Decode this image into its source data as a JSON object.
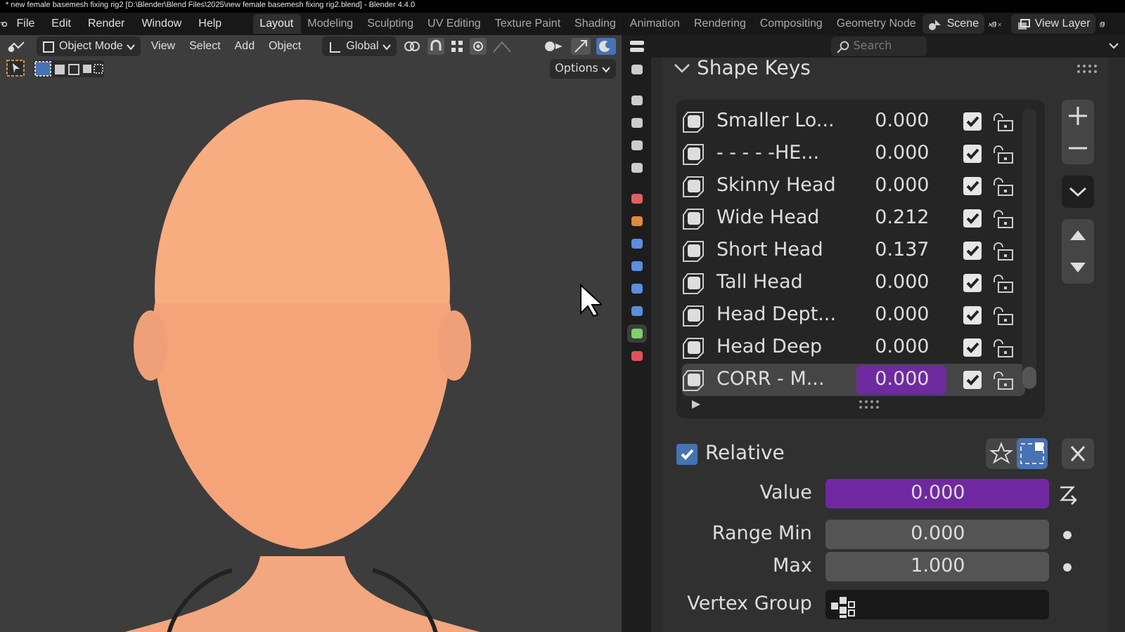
{
  "window": {
    "title": "* new female basemesh fixing rig2 [D:\\Blender\\Blend Files\\2025\\new female basemesh fixing rig2.blend] - Blender 4.4.0"
  },
  "menu": [
    "File",
    "Edit",
    "Render",
    "Window",
    "Help"
  ],
  "workspaces": [
    {
      "label": "Layout",
      "selected": true
    },
    {
      "label": "Modeling",
      "selected": false
    },
    {
      "label": "Sculpting",
      "selected": false
    },
    {
      "label": "UV Editing",
      "selected": false
    },
    {
      "label": "Texture Paint",
      "selected": false
    },
    {
      "label": "Shading",
      "selected": false
    },
    {
      "label": "Animation",
      "selected": false
    },
    {
      "label": "Rendering",
      "selected": false
    },
    {
      "label": "Compositing",
      "selected": false
    },
    {
      "label": "Geometry Node",
      "selected": false
    }
  ],
  "scene": {
    "name": "Scene"
  },
  "view_layer": {
    "name": "View Layer"
  },
  "viewport": {
    "mode": "Object Mode",
    "menus": [
      "View",
      "Select",
      "Add",
      "Object"
    ],
    "orientation": "Global",
    "options": "Options"
  },
  "properties": {
    "search": {
      "placeholder": "Search"
    },
    "tabs": [
      {
        "selected": false
      },
      {
        "selected": false
      },
      {
        "selected": false
      },
      {
        "selected": false
      },
      {
        "selected": false
      },
      {
        "selected": false
      },
      {
        "selected": false
      },
      {
        "selected": false
      },
      {
        "selected": false
      },
      {
        "selected": false
      },
      {
        "selected": false
      },
      {
        "selected": true
      },
      {
        "selected": false
      }
    ],
    "panel_title": "Shape Keys",
    "shape_keys": [
      {
        "name": "Smaller Lo...",
        "value": "0.000",
        "enabled": true,
        "driven": false,
        "selected": false
      },
      {
        "name": "- - - - -HE...",
        "value": "0.000",
        "enabled": true,
        "driven": false,
        "selected": false
      },
      {
        "name": "Skinny Head",
        "value": "0.000",
        "enabled": true,
        "driven": false,
        "selected": false
      },
      {
        "name": "Wide Head",
        "value": "0.212",
        "enabled": true,
        "driven": false,
        "selected": false
      },
      {
        "name": "Short Head",
        "value": "0.137",
        "enabled": true,
        "driven": false,
        "selected": false
      },
      {
        "name": "Tall Head",
        "value": "0.000",
        "enabled": true,
        "driven": false,
        "selected": false
      },
      {
        "name": "Head Dept...",
        "value": "0.000",
        "enabled": true,
        "driven": false,
        "selected": false
      },
      {
        "name": "Head Deep",
        "value": "0.000",
        "enabled": true,
        "driven": false,
        "selected": false
      },
      {
        "name": "CORR - M...",
        "value": "0.000",
        "enabled": true,
        "driven": true,
        "selected": true
      }
    ],
    "relative": {
      "label": "Relative",
      "checked": true
    },
    "fields": [
      {
        "label": "Value",
        "value": "0.000",
        "driven": true,
        "kind": "number"
      },
      {
        "label": "Range Min",
        "value": "0.000",
        "driven": false,
        "kind": "number"
      },
      {
        "label": "Max",
        "value": "1.000",
        "driven": false,
        "kind": "number"
      },
      {
        "label": "Vertex Group",
        "kind": "group"
      }
    ]
  }
}
